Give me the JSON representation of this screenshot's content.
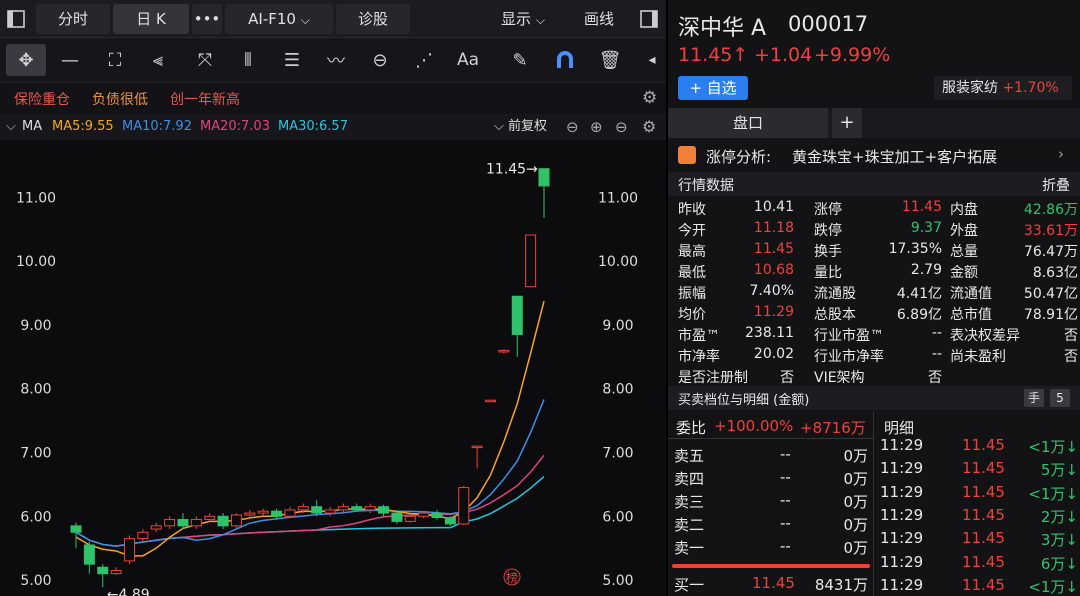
{
  "topbar": {
    "fenshi": "分时",
    "rik": "日 K",
    "more": "•••",
    "aif10": "AI-F10",
    "zhengu": "诊股",
    "display": "显示",
    "huaxian": "画线"
  },
  "tags": [
    "保险重仓",
    "负债很低",
    "创一年新高"
  ],
  "ma": {
    "name": "MA",
    "ma5": "MA5:9.55",
    "ma10": "MA10:7.92",
    "ma20": "MA20:7.03",
    "ma30": "MA30:6.57",
    "adjust": "前复权"
  },
  "colors": {
    "ma5": "#f5a623",
    "ma10": "#3d8fe6",
    "ma20": "#e0447e",
    "ma30": "#27c4e0",
    "up": "#f0403c",
    "down": "#2fc26b"
  },
  "chart_data": {
    "type": "candlestick",
    "ylim": [
      4.75,
      11.9
    ],
    "yticks": [
      "11.00",
      "10.00",
      "9.00",
      "8.00",
      "7.00",
      "6.00",
      "5.00"
    ],
    "high_label": "11.45",
    "low_label": "4.89",
    "badge": "榜",
    "candles": [
      [
        5.85,
        5.75,
        5.9,
        5.5
      ],
      [
        5.55,
        5.25,
        5.6,
        5.1
      ],
      [
        5.2,
        5.1,
        5.25,
        4.89
      ],
      [
        5.1,
        5.15,
        5.2,
        5.08
      ],
      [
        5.3,
        5.65,
        5.7,
        5.25
      ],
      [
        5.65,
        5.75,
        5.8,
        5.6
      ],
      [
        5.8,
        5.85,
        5.9,
        5.75
      ],
      [
        5.85,
        5.95,
        6.0,
        5.8
      ],
      [
        5.95,
        5.85,
        6.05,
        5.8
      ],
      [
        5.85,
        5.95,
        6.0,
        5.8
      ],
      [
        5.95,
        6.0,
        6.05,
        5.9
      ],
      [
        6.0,
        5.85,
        6.05,
        5.8
      ],
      [
        5.85,
        6.02,
        6.05,
        5.82
      ],
      [
        6.02,
        6.05,
        6.1,
        5.98
      ],
      [
        6.05,
        6.08,
        6.12,
        6.0
      ],
      [
        6.08,
        6.0,
        6.12,
        5.95
      ],
      [
        6.0,
        6.1,
        6.15,
        5.98
      ],
      [
        6.1,
        6.15,
        6.2,
        6.05
      ],
      [
        6.15,
        6.05,
        6.25,
        6.0
      ],
      [
        6.05,
        6.1,
        6.15,
        6.0
      ],
      [
        6.1,
        6.15,
        6.2,
        6.05
      ],
      [
        6.15,
        6.1,
        6.2,
        6.08
      ],
      [
        6.1,
        6.15,
        6.2,
        6.05
      ],
      [
        6.15,
        6.05,
        6.18,
        6.0
      ],
      [
        6.05,
        5.92,
        6.1,
        5.88
      ],
      [
        5.92,
        6.0,
        6.02,
        5.9
      ],
      [
        6.0,
        6.05,
        6.08,
        5.97
      ],
      [
        6.05,
        5.98,
        6.1,
        5.95
      ],
      [
        5.98,
        5.88,
        6.0,
        5.85
      ],
      [
        5.88,
        6.45,
        6.48,
        5.86
      ],
      [
        7.1,
        7.1,
        7.1,
        6.75
      ],
      [
        7.82,
        7.82,
        7.82,
        7.82
      ],
      [
        8.6,
        8.6,
        8.62,
        8.55
      ],
      [
        9.45,
        8.85,
        9.45,
        8.5
      ],
      [
        9.6,
        10.41,
        10.41,
        9.6
      ],
      [
        11.45,
        11.18,
        11.45,
        10.68
      ]
    ]
  },
  "stock": {
    "name": "深中华 A",
    "code": "000017",
    "price": "11.45↑",
    "change": "+1.04",
    "pct": "+9.99%",
    "add_btn": "+ 自选",
    "industry": "服装家纺",
    "industry_pct": "+1.70%"
  },
  "tabs": {
    "pankou": "盘口",
    "plus": "+"
  },
  "limit": {
    "label": "涨停分析:",
    "text": "黄金珠宝+珠宝加工+客户拓展"
  },
  "quote": {
    "title": "行情数据",
    "fold": "折叠",
    "rows": [
      [
        [
          "昨收",
          "10.41",
          "w"
        ],
        [
          "涨停",
          "11.45",
          "r"
        ],
        [
          "内盘",
          "42.86万",
          "g"
        ]
      ],
      [
        [
          "今开",
          "11.18",
          "r"
        ],
        [
          "跌停",
          "9.37",
          "g"
        ],
        [
          "外盘",
          "33.61万",
          "r"
        ]
      ],
      [
        [
          "最高",
          "11.45",
          "r"
        ],
        [
          "换手",
          "17.35%",
          "w"
        ],
        [
          "总量",
          "76.47万",
          "w"
        ]
      ],
      [
        [
          "最低",
          "10.68",
          "r"
        ],
        [
          "量比",
          "2.79",
          "w"
        ],
        [
          "金额",
          "8.63亿",
          "w"
        ]
      ],
      [
        [
          "振幅",
          "7.40%",
          "w"
        ],
        [
          "流通股",
          "4.41亿",
          "w"
        ],
        [
          "流通值",
          "50.47亿",
          "w"
        ]
      ],
      [
        [
          "均价",
          "11.29",
          "r"
        ],
        [
          "总股本",
          "6.89亿",
          "w"
        ],
        [
          "总市值",
          "78.91亿",
          "w"
        ]
      ],
      [
        [
          "市盈™",
          "238.11",
          "w"
        ],
        [
          "行业市盈™",
          "--",
          "w"
        ],
        [
          "表决权差异",
          "否",
          "w"
        ]
      ],
      [
        [
          "市净率",
          "20.02",
          "w"
        ],
        [
          "行业市净率",
          "--",
          "w"
        ],
        [
          "尚未盈利",
          "否",
          "w"
        ]
      ],
      [
        [
          "是否注册制",
          "否",
          "w"
        ],
        [
          "VIE架构",
          "否",
          "w"
        ],
        [
          "",
          "",
          " w"
        ]
      ]
    ]
  },
  "depth": {
    "title": "买卖档位与明细 (金额)",
    "hand": "手",
    "five": "5",
    "weibi_label": "委比",
    "weibi": "+100.00%",
    "weibi_amt": "+8716万",
    "asks": [
      [
        "卖五",
        "--",
        "0万"
      ],
      [
        "卖四",
        "--",
        "0万"
      ],
      [
        "卖三",
        "--",
        "0万"
      ],
      [
        "卖二",
        "--",
        "0万"
      ],
      [
        "卖一",
        "--",
        "0万"
      ]
    ],
    "bid1": [
      "买一",
      "11.45",
      "8431万"
    ]
  },
  "detail": {
    "title": "明细",
    "rows": [
      [
        "11:29",
        "11.45",
        "<1万↓"
      ],
      [
        "11:29",
        "11.45",
        "5万↓"
      ],
      [
        "11:29",
        "11.45",
        "<1万↓"
      ],
      [
        "11:29",
        "11.45",
        "2万↓"
      ],
      [
        "11:29",
        "11.45",
        "3万↓"
      ],
      [
        "11:29",
        "11.45",
        "6万↓"
      ],
      [
        "11:29",
        "11.45",
        "<1万↓"
      ]
    ]
  }
}
